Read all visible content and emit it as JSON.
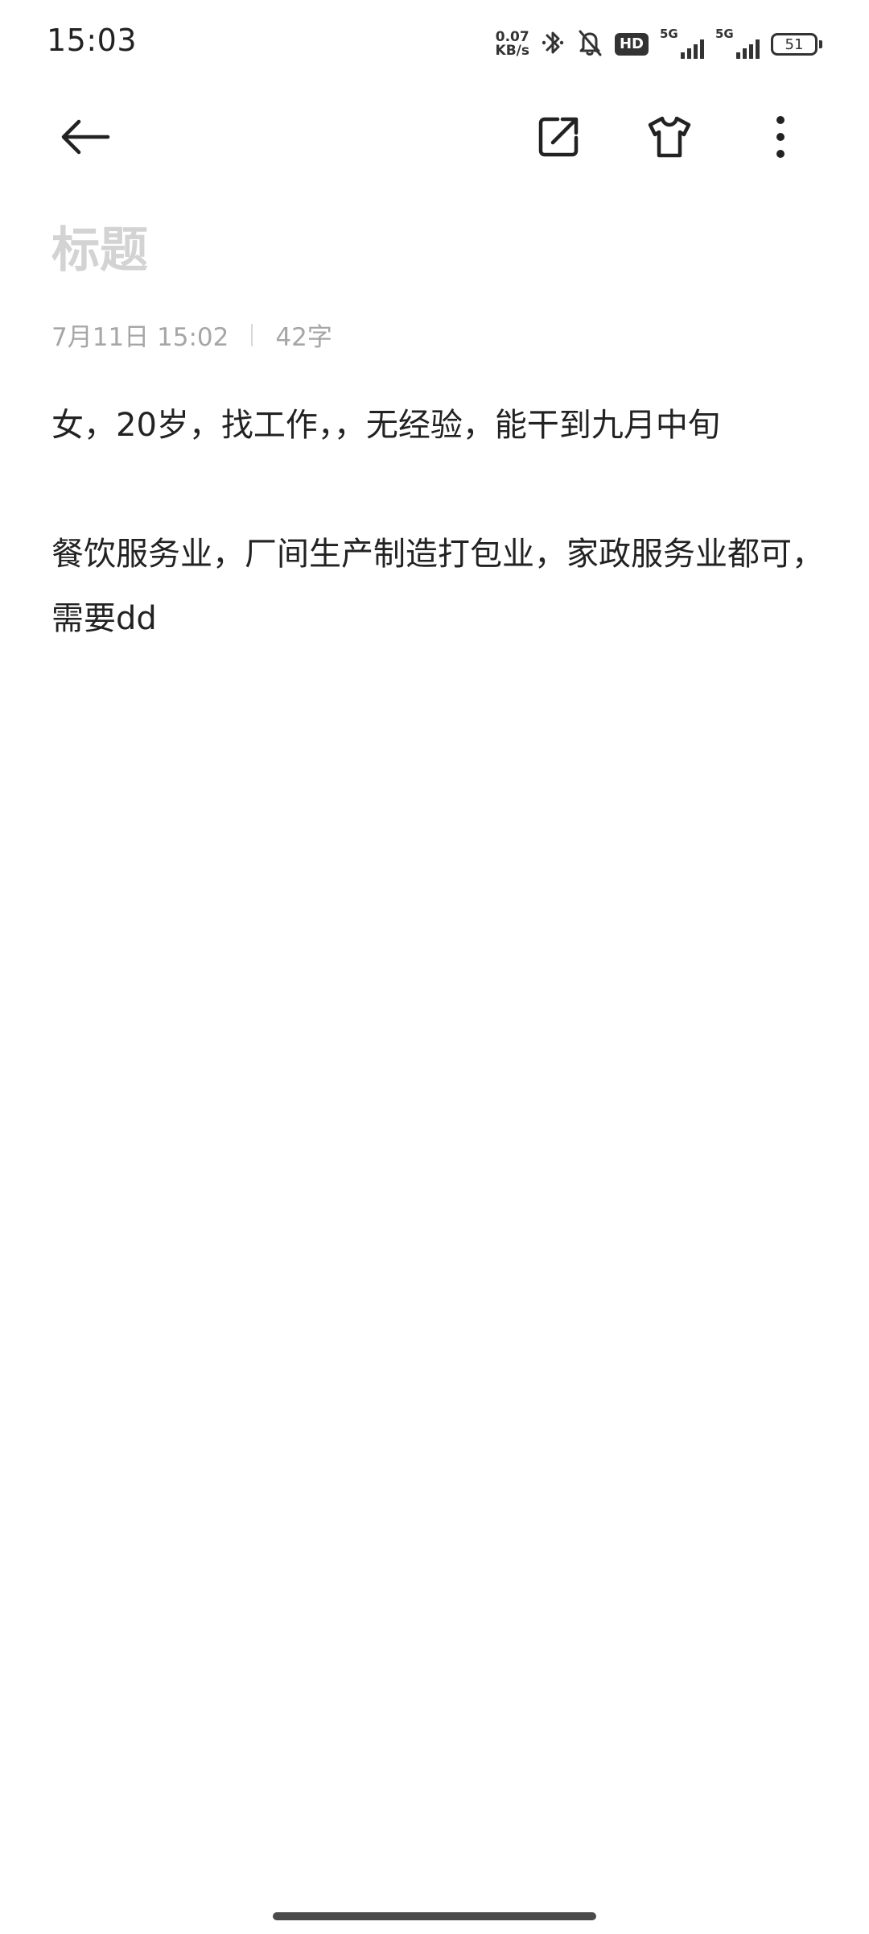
{
  "status_bar": {
    "time": "15:03",
    "net_speed_value": "0.07",
    "net_speed_unit": "KB/s",
    "hd_badge": "HD",
    "signal1_label": "5G",
    "signal2_label": "5G",
    "battery": "51"
  },
  "toolbar": {
    "back_icon": "arrow-left-icon",
    "share_icon": "share-external-icon",
    "theme_icon": "tshirt-icon",
    "more_icon": "more-vertical-icon"
  },
  "note": {
    "title_placeholder": "标题",
    "date": "7月11日 15:02",
    "word_count": "42字",
    "paragraph1": "女，20岁，找工作，，无经验，能干到九月中旬",
    "paragraph2": "餐饮服务业，厂间生产制造打包业，家政服务业都可，需要dd"
  }
}
